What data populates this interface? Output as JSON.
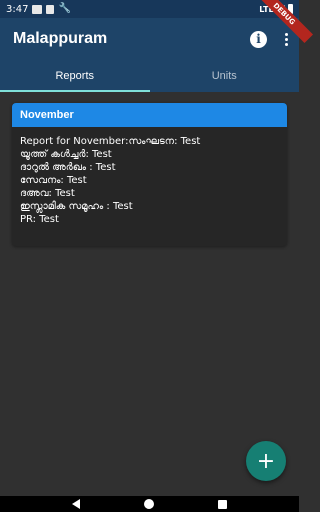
{
  "status_bar": {
    "time": "3:47",
    "network": "LTE",
    "icons": [
      "message-icon",
      "sd-card-icon",
      "wrench-icon",
      "signal-icon",
      "battery-icon"
    ]
  },
  "debug_banner": "DEBUG",
  "app_bar": {
    "title": "Malappuram",
    "actions": [
      "info-icon",
      "more-vert-icon"
    ]
  },
  "tabs": [
    {
      "label": "Reports",
      "active": true
    },
    {
      "label": "Units",
      "active": false
    }
  ],
  "report_card": {
    "header": "November",
    "lines": [
      "Report for November:സംഘടന: Test",
      "യൂത്ത് കൾച്ചർ: Test",
      "ദാറുൽ അർഖം : Test",
      "സേവനം: Test",
      "ദഅവ: Test",
      "ഇസ്ലാമിക സമൂഹം : Test",
      "PR: Test"
    ]
  },
  "fab": {
    "label": "+",
    "icon": "add-icon"
  },
  "nav_bar": {
    "icons": [
      "back-icon",
      "home-icon",
      "recents-icon"
    ]
  },
  "colors": {
    "status_bar": "#17375a",
    "app_bar": "#1e4468",
    "tab_indicator": "#7fe0d8",
    "card_header": "#1e88e5",
    "fab": "#167f73",
    "background": "#303030"
  }
}
